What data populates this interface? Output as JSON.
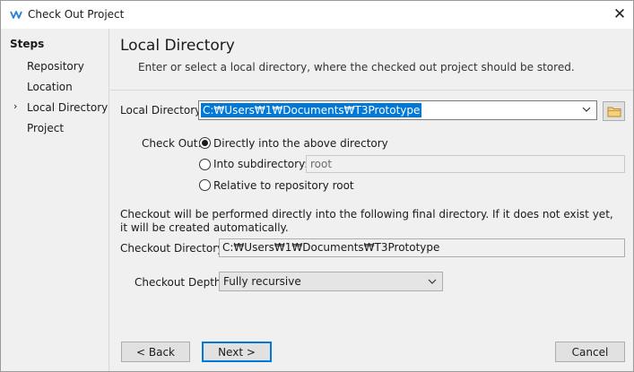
{
  "window": {
    "title": "Check Out Project",
    "close_glyph": "✕"
  },
  "sidebar": {
    "heading": "Steps",
    "current_marker": "›",
    "items": [
      {
        "label": "Repository"
      },
      {
        "label": "Location"
      },
      {
        "label": "Local Directory",
        "current": true
      },
      {
        "label": "Project"
      }
    ]
  },
  "header": {
    "title": "Local Directory",
    "description": "Enter or select a local directory, where the checked out project should be stored."
  },
  "local_directory": {
    "label": "Local Directory:",
    "value": "C:₩Users₩1₩Documents₩T3Prototype"
  },
  "check_out": {
    "label": "Check Out:",
    "options": [
      {
        "label": "Directly into the above directory",
        "checked": true
      },
      {
        "label": "Into subdirectory:",
        "checked": false
      },
      {
        "label": "Relative to repository root",
        "checked": false
      }
    ],
    "subdirectory_value": "root"
  },
  "info_text": "Checkout will be performed directly into the following final directory. If it does not exist yet, it will be created automatically.",
  "checkout_directory": {
    "label": "Checkout Directory:",
    "value": "C:₩Users₩1₩Documents₩T3Prototype"
  },
  "checkout_depth": {
    "label": "Checkout Depth:",
    "selected": "Fully recursive"
  },
  "buttons": {
    "back": "< Back",
    "next": "Next >",
    "cancel": "Cancel"
  },
  "colors": {
    "selection": "#0078d7",
    "folder_icon": "#dcb05a",
    "app_icon": "#2a7fd4"
  }
}
